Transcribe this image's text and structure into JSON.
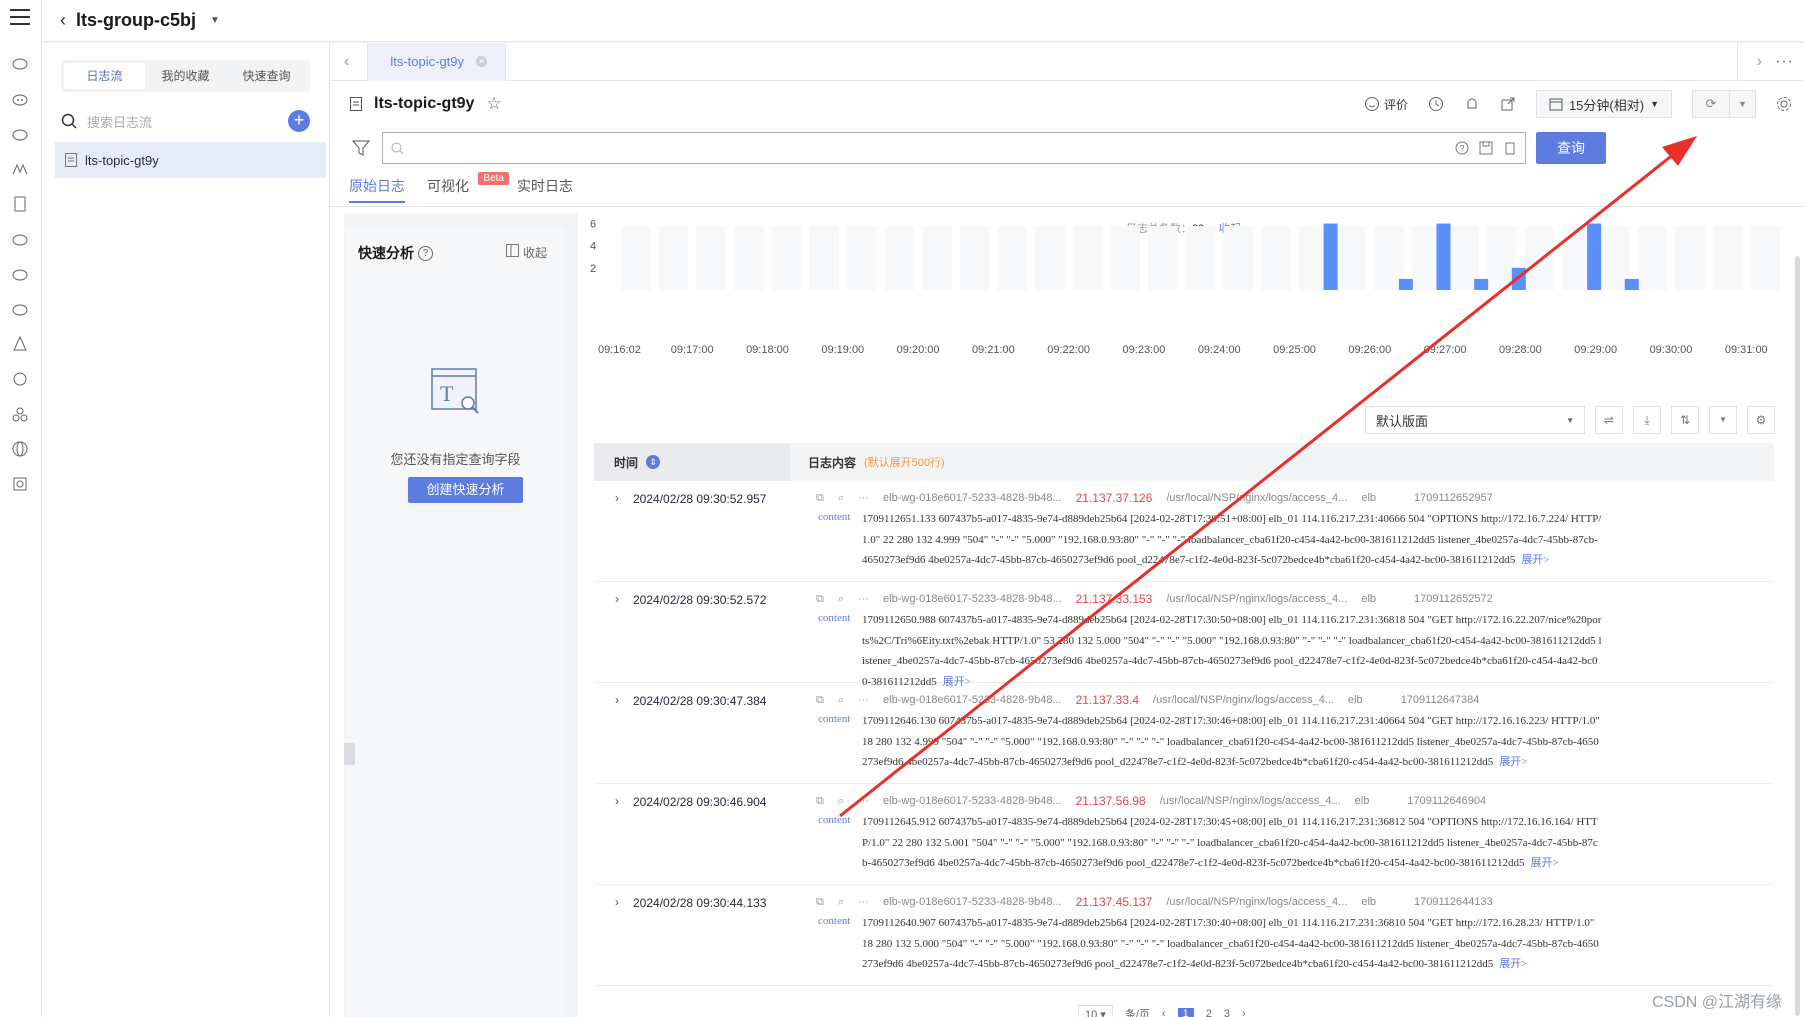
{
  "header": {
    "group_name": "lts-group-c5bj"
  },
  "sidebar": {
    "tabs": [
      "日志流",
      "我的收藏",
      "快速查询"
    ],
    "search_placeholder": "搜索日志流",
    "add_label": "+",
    "streams": [
      "lts-topic-gt9y"
    ]
  },
  "tabbar": {
    "tab_label": "lts-topic-gt9y"
  },
  "titlebar": {
    "title": "lts-topic-gt9y",
    "rate_label": "评价",
    "time_range": "15分钟(相对)"
  },
  "query": {
    "button_label": "查询"
  },
  "subtabs": {
    "raw": "原始日志",
    "visual": "可视化",
    "beta": "Beta",
    "realtime": "实时日志"
  },
  "quick_analysis": {
    "title": "快速分析",
    "collapse_label": "收起",
    "empty_text": "您还没有指定查询字段",
    "create_label": "创建快速分析"
  },
  "summary": {
    "label": "日志总条数：",
    "count": "23",
    "collapse_link": "收起"
  },
  "chart_data": {
    "type": "bar",
    "y_ticks": [
      "6",
      "4",
      "2"
    ],
    "ylim": [
      0,
      6.5
    ],
    "x_tick_labels": [
      "09:16:02",
      "09:17:00",
      "09:18:00",
      "09:19:00",
      "09:20:00",
      "09:21:00",
      "09:22:00",
      "09:23:00",
      "09:24:00",
      "09:25:00",
      "09:26:00",
      "09:27:00",
      "09:28:00",
      "09:29:00",
      "09:30:00",
      "09:31:00"
    ],
    "bars": [
      {
        "time": "09:25:30",
        "value": 6
      },
      {
        "time": "09:26:30",
        "value": 1
      },
      {
        "time": "09:27:00",
        "value": 6
      },
      {
        "time": "09:27:30",
        "value": 1
      },
      {
        "time": "09:28:00",
        "value": 2
      },
      {
        "time": "09:29:00",
        "value": 6
      },
      {
        "time": "09:29:30",
        "value": 1
      }
    ],
    "bar_color": "#5b8ff9"
  },
  "view": {
    "layout_label": "默认版面"
  },
  "table": {
    "time_header": "时间",
    "content_header": "日志内容",
    "content_hint": "(默认展开500行)",
    "content_key": "content",
    "expand_label": "展开>",
    "rows": [
      {
        "time": "2024/02/28 09:30:52.957",
        "id": "elb-wg-018e6017-5233-4828-9b48...",
        "ip": "21.137.37.126",
        "path": "/usr/local/NSP/nginx/logs/access_4...",
        "source": "elb",
        "stamp": "1709112652957",
        "content": "1709112651.133 607437b5-a017-4835-9e74-d889deb25b64 [2024-02-28T17:30:51+08:00] elb_01 114.116.217.231:40666 504 \"OPTIONS http://172.16.7.224/ HTTP/1.0\" 22 280 132 4.999 \"504\" \"-\" \"-\" \"5.000\" \"192.168.0.93:80\" \"-\" \"-\" \"-\" loadbalancer_cba61f20-c454-4a42-bc00-381611212dd5 listener_4be0257a-4dc7-45bb-87cb-4650273ef9d6 4be0257a-4dc7-45bb-87cb-4650273ef9d6 pool_d22478e7-c1f2-4e0d-823f-5c072bedce4b*cba61f20-c454-4a42-bc00-381611212dd5"
      },
      {
        "time": "2024/02/28 09:30:52.572",
        "id": "elb-wg-018e6017-5233-4828-9b48...",
        "ip": "21.137.33.153",
        "path": "/usr/local/NSP/nginx/logs/access_4...",
        "source": "elb",
        "stamp": "1709112652572",
        "content": "1709112650.988 607437b5-a017-4835-9e74-d889deb25b64 [2024-02-28T17:30:50+08:00] elb_01 114.116.217.231:36818 504 \"GET http://172.16.22.207/nice%20ports%2C/Tri%6Eity.txt%2ebak HTTP/1.0\" 53 280 132 5.000 \"504\" \"-\" \"-\" \"5.000\" \"192.168.0.93:80\" \"-\" \"-\" \"-\" loadbalancer_cba61f20-c454-4a42-bc00-381611212dd5 listener_4be0257a-4dc7-45bb-87cb-4650273ef9d6 4be0257a-4dc7-45bb-87cb-4650273ef9d6 pool_d22478e7-c1f2-4e0d-823f-5c072bedce4b*cba61f20-c454-4a42-bc00-381611212dd5"
      },
      {
        "time": "2024/02/28 09:30:47.384",
        "id": "elb-wg-018e6017-5233-4828-9b48...",
        "ip": "21.137.33.4",
        "path": "/usr/local/NSP/nginx/logs/access_4...",
        "source": "elb",
        "stamp": "1709112647384",
        "content": "1709112646.130 607437b5-a017-4835-9e74-d889deb25b64 [2024-02-28T17:30:46+08:00] elb_01 114.116.217.231:40664 504 \"GET http://172.16.16.223/ HTTP/1.0\" 18 280 132 4.999 \"504\" \"-\" \"-\" \"5.000\" \"192.168.0.93:80\" \"-\" \"-\" \"-\" loadbalancer_cba61f20-c454-4a42-bc00-381611212dd5 listener_4be0257a-4dc7-45bb-87cb-4650273ef9d6 4be0257a-4dc7-45bb-87cb-4650273ef9d6 pool_d22478e7-c1f2-4e0d-823f-5c072bedce4b*cba61f20-c454-4a42-bc00-381611212dd5"
      },
      {
        "time": "2024/02/28 09:30:46.904",
        "id": "elb-wg-018e6017-5233-4828-9b48...",
        "ip": "21.137.56.98",
        "path": "/usr/local/NSP/nginx/logs/access_4...",
        "source": "elb",
        "stamp": "1709112646904",
        "content": "1709112645.912 607437b5-a017-4835-9e74-d889deb25b64 [2024-02-28T17:30:45+08:00] elb_01 114.116.217.231:36812 504 \"OPTIONS http://172.16.16.164/ HTTP/1.0\" 22 280 132 5.001 \"504\" \"-\" \"-\" \"5.000\" \"192.168.0.93:80\" \"-\" \"-\" \"-\" loadbalancer_cba61f20-c454-4a42-bc00-381611212dd5 listener_4be0257a-4dc7-45bb-87cb-4650273ef9d6 4be0257a-4dc7-45bb-87cb-4650273ef9d6 pool_d22478e7-c1f2-4e0d-823f-5c072bedce4b*cba61f20-c454-4a42-bc00-381611212dd5"
      },
      {
        "time": "2024/02/28 09:30:44.133",
        "id": "elb-wg-018e6017-5233-4828-9b48...",
        "ip": "21.137.45.137",
        "path": "/usr/local/NSP/nginx/logs/access_4...",
        "source": "elb",
        "stamp": "1709112644133",
        "content": "1709112640.907 607437b5-a017-4835-9e74-d889deb25b64 [2024-02-28T17:30:40+08:00] elb_01 114.116.217.231:36810 504 \"GET http://172.16.28.23/ HTTP/1.0\" 18 280 132 5.000 \"504\" \"-\" \"-\" \"5.000\" \"192.168.0.93:80\" \"-\" \"-\" \"-\" loadbalancer_cba61f20-c454-4a42-bc00-381611212dd5 listener_4be0257a-4dc7-45bb-87cb-4650273ef9d6 4be0257a-4dc7-45bb-87cb-4650273ef9d6 pool_d22478e7-c1f2-4e0d-823f-5c072bedce4b*cba61f20-c454-4a42-bc00-381611212dd5"
      }
    ]
  },
  "pager": {
    "size": "10",
    "unit": "条/页",
    "pages": [
      "1",
      "2",
      "3"
    ]
  },
  "watermark": "CSDN @江湖有缘",
  "annotation_color": "#e8302a"
}
